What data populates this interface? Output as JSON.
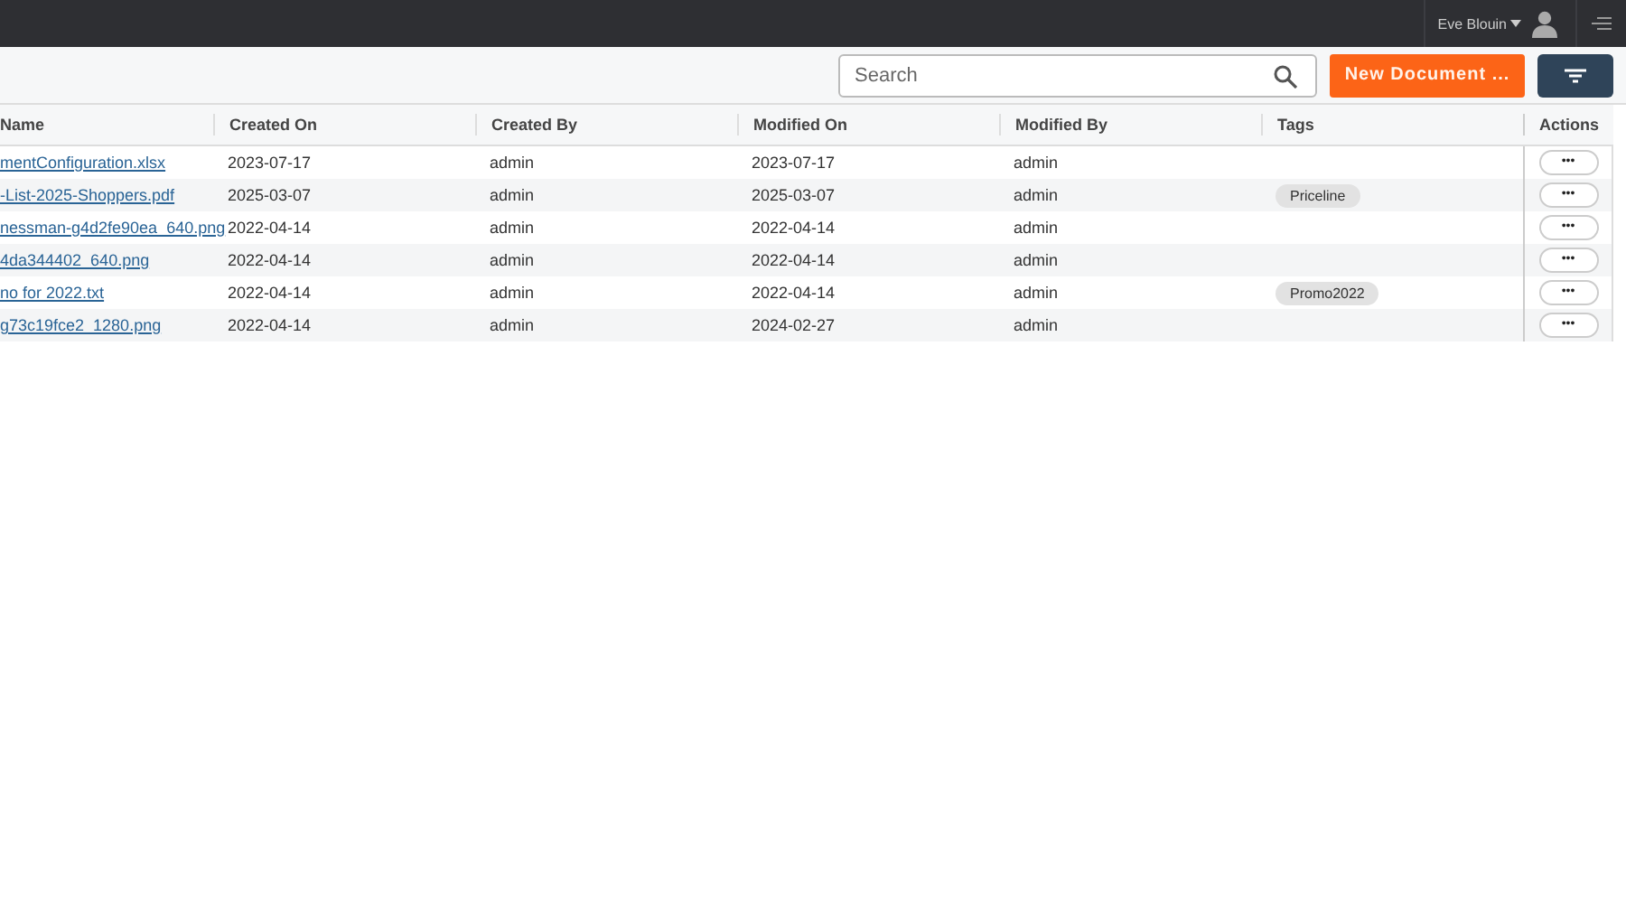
{
  "user_menu": {
    "name": "Eve Blouin"
  },
  "search": {
    "placeholder": "Search"
  },
  "new_document_button": {
    "label": "New Document ..."
  },
  "table": {
    "columns": [
      "Name",
      "Created On",
      "Created By",
      "Modified On",
      "Modified By",
      "Tags",
      "Actions"
    ],
    "rows": [
      {
        "name": "mentConfiguration.xlsx",
        "created_on": "2023-07-17",
        "created_by": "admin",
        "modified_on": "2023-07-17",
        "modified_by": "admin",
        "tags": [],
        "action": "•••"
      },
      {
        "name": "-List-2025-Shoppers.pdf",
        "created_on": "2025-03-07",
        "created_by": "admin",
        "modified_on": "2025-03-07",
        "modified_by": "admin",
        "tags": [
          "Priceline"
        ],
        "action": "•••"
      },
      {
        "name": "nessman-g4d2fe90ea_640.png",
        "created_on": "2022-04-14",
        "created_by": "admin",
        "modified_on": "2022-04-14",
        "modified_by": "admin",
        "tags": [],
        "action": "•••"
      },
      {
        "name": "4da344402_640.png",
        "created_on": "2022-04-14",
        "created_by": "admin",
        "modified_on": "2022-04-14",
        "modified_by": "admin",
        "tags": [],
        "action": "•••"
      },
      {
        "name": "no for 2022.txt",
        "created_on": "2022-04-14",
        "created_by": "admin",
        "modified_on": "2022-04-14",
        "modified_by": "admin",
        "tags": [
          "Promo2022"
        ],
        "action": "•••"
      },
      {
        "name": "g73c19fce2_1280.png",
        "created_on": "2022-04-14",
        "created_by": "admin",
        "modified_on": "2024-02-27",
        "modified_by": "admin",
        "tags": [],
        "action": "•••"
      }
    ]
  }
}
